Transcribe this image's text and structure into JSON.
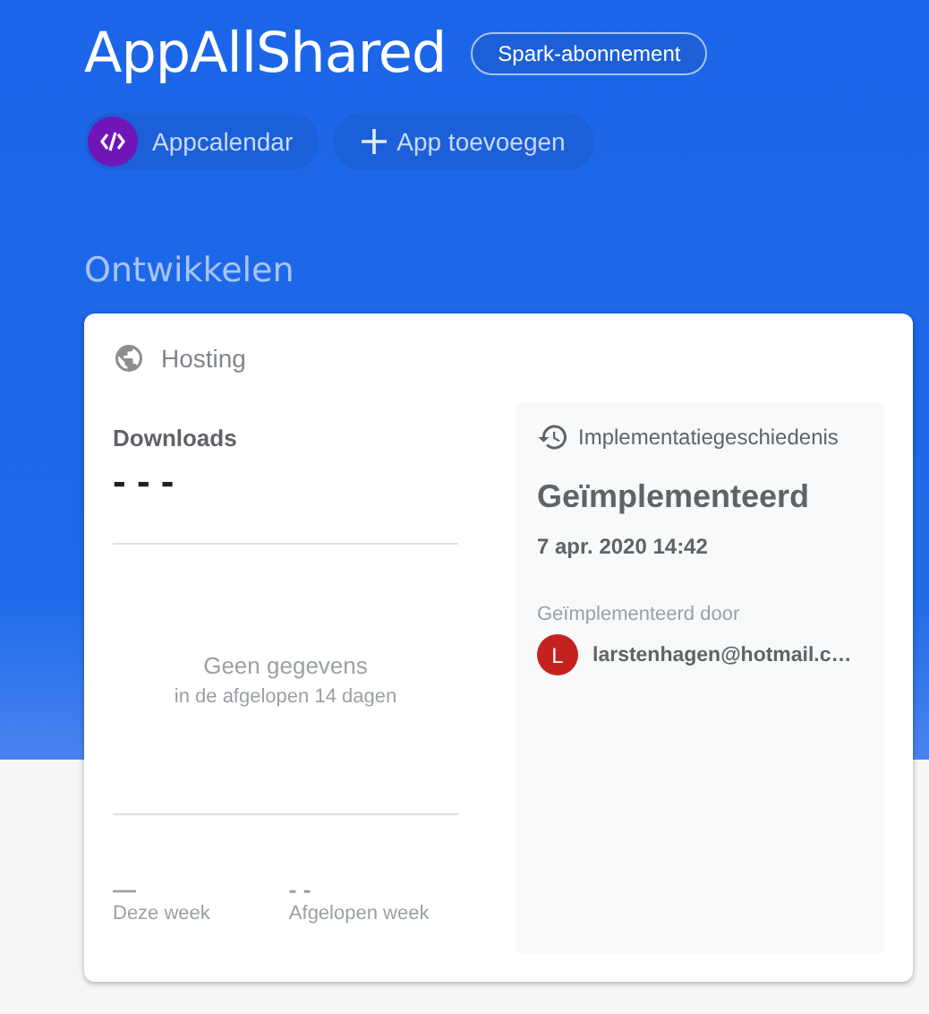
{
  "project": {
    "title": "AppAllShared",
    "plan_badge": "Spark-abonnement"
  },
  "apps": [
    {
      "kind": "app",
      "label": "Appcalendar"
    },
    {
      "kind": "add",
      "label": "App toevoegen"
    }
  ],
  "section_title": "Ontwikkelen",
  "card": {
    "title": "Hosting",
    "downloads": {
      "label": "Downloads",
      "value": "- - -",
      "empty_title": "Geen gegevens",
      "empty_subtitle": "in de afgelopen 14 dagen",
      "stats": [
        {
          "value": "—",
          "label": "Deze week"
        },
        {
          "value": "- -",
          "label": "Afgelopen week"
        }
      ]
    },
    "history": {
      "title": "Implementatiegeschiedenis",
      "status": "Geïmplementeerd",
      "date": "7 apr. 2020 14:42",
      "by_label": "Geïmplementeerd door",
      "user": {
        "initial": "L",
        "email": "larstenhagen@hotmail.c…",
        "color": "#c5221f"
      }
    }
  }
}
